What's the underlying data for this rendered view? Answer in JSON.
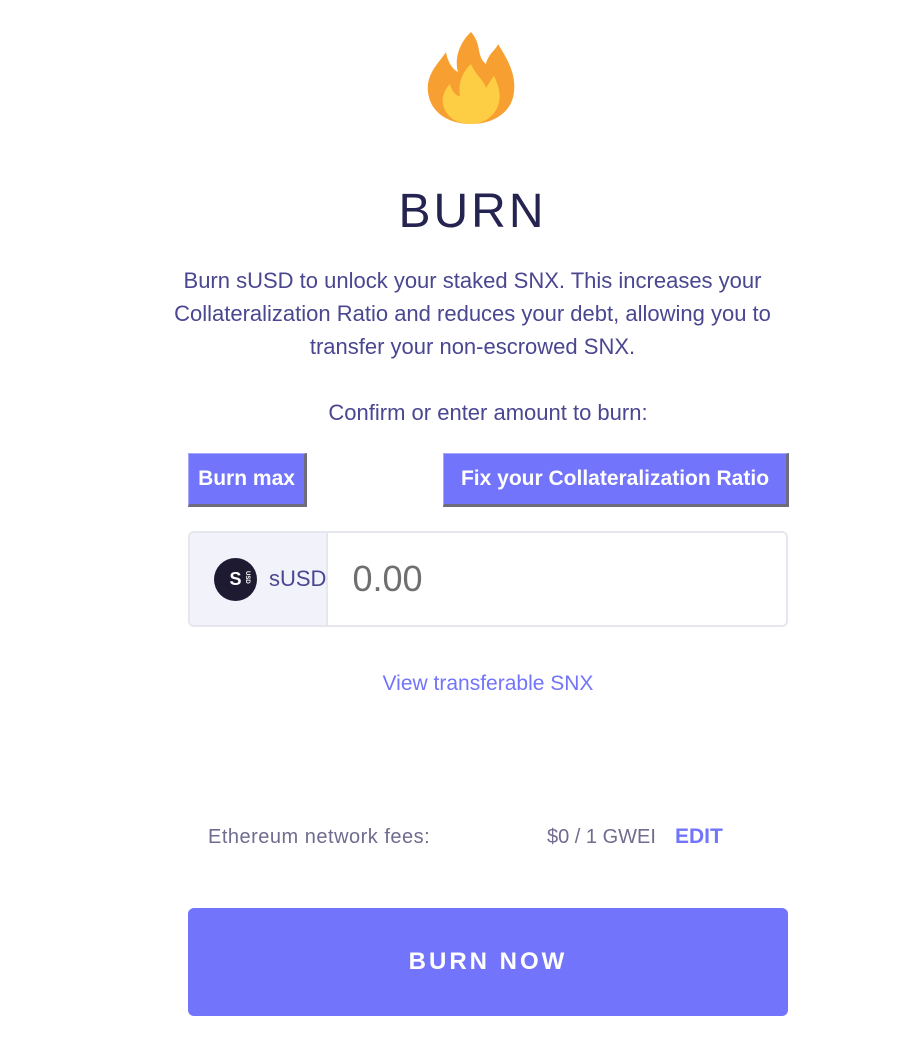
{
  "icon": "fire-icon",
  "title": "BURN",
  "description": "Burn sUSD to unlock your staked SNX. This increases your Collateralization Ratio and reduces your debt, allowing you to transfer your non-escrowed SNX.",
  "prompt": "Confirm or enter amount to burn:",
  "buttons": {
    "burn_max": "Burn max",
    "fix_ratio": "Fix your Collateralization Ratio",
    "burn_now": "BURN NOW"
  },
  "input": {
    "currency_icon": "susd-token-icon",
    "currency_icon_text": "S",
    "currency_icon_sub": "USD",
    "currency": "sUSD",
    "placeholder": "0.00",
    "value": ""
  },
  "links": {
    "view_transferable": "View transferable SNX"
  },
  "fees": {
    "label": "Ethereum network fees:",
    "value": "$0 / 1 GWEI",
    "edit": "EDIT"
  },
  "colors": {
    "accent": "#7274fb",
    "title": "#25234f",
    "text": "#4a4690",
    "token_bg": "#1e1a31"
  }
}
